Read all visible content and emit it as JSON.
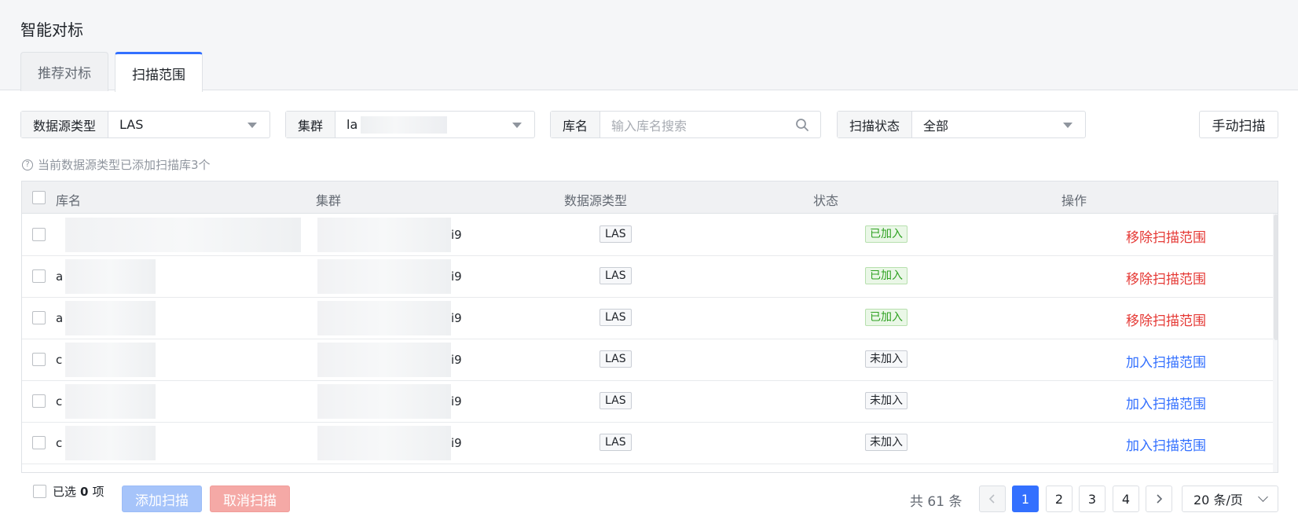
{
  "page": {
    "title": "智能对标"
  },
  "tabs": [
    {
      "label": "推荐对标",
      "active": false
    },
    {
      "label": "扫描范围",
      "active": true
    }
  ],
  "filters": {
    "datasource": {
      "label": "数据源类型",
      "value": "LAS"
    },
    "cluster": {
      "label": "集群",
      "value": "la"
    },
    "dbname": {
      "label": "库名",
      "placeholder": "输入库名搜索"
    },
    "scan_status": {
      "label": "扫描状态",
      "value": "全部"
    }
  },
  "manual_scan_label": "手动扫描",
  "hint": "当前数据源类型已添加扫描库3个",
  "table": {
    "headers": {
      "db": "库名",
      "cluster": "集群",
      "type": "数据源类型",
      "status": "状态",
      "ops": "操作"
    },
    "rows": [
      {
        "db": "",
        "cluster_suffix": "i9",
        "type": "LAS",
        "status": "已加入",
        "joined": true,
        "op": "移除扫描范围"
      },
      {
        "db": "a",
        "cluster_suffix": "i9",
        "type": "LAS",
        "status": "已加入",
        "joined": true,
        "op": "移除扫描范围"
      },
      {
        "db": "a",
        "cluster_suffix": "i9",
        "type": "LAS",
        "status": "已加入",
        "joined": true,
        "op": "移除扫描范围"
      },
      {
        "db": "c",
        "cluster_suffix": "i9",
        "type": "LAS",
        "status": "未加入",
        "joined": false,
        "op": "加入扫描范围"
      },
      {
        "db": "c",
        "cluster_suffix": "i9",
        "type": "LAS",
        "status": "未加入",
        "joined": false,
        "op": "加入扫描范围"
      },
      {
        "db": "c",
        "cluster_suffix": "i9",
        "type": "LAS",
        "status": "未加入",
        "joined": false,
        "op": "加入扫描范围"
      }
    ]
  },
  "footer": {
    "selected_prefix": "已选",
    "selected_count": "0",
    "selected_suffix": "项",
    "add_scan_label": "添加扫描",
    "cancel_scan_label": "取消扫描",
    "total_text": "共 61 条",
    "pages": [
      "1",
      "2",
      "3",
      "4"
    ],
    "current_page": "1",
    "page_size": "20 条/页"
  },
  "colors": {
    "primary": "#3370ff",
    "danger": "#e53935",
    "success": "#2ea121"
  }
}
